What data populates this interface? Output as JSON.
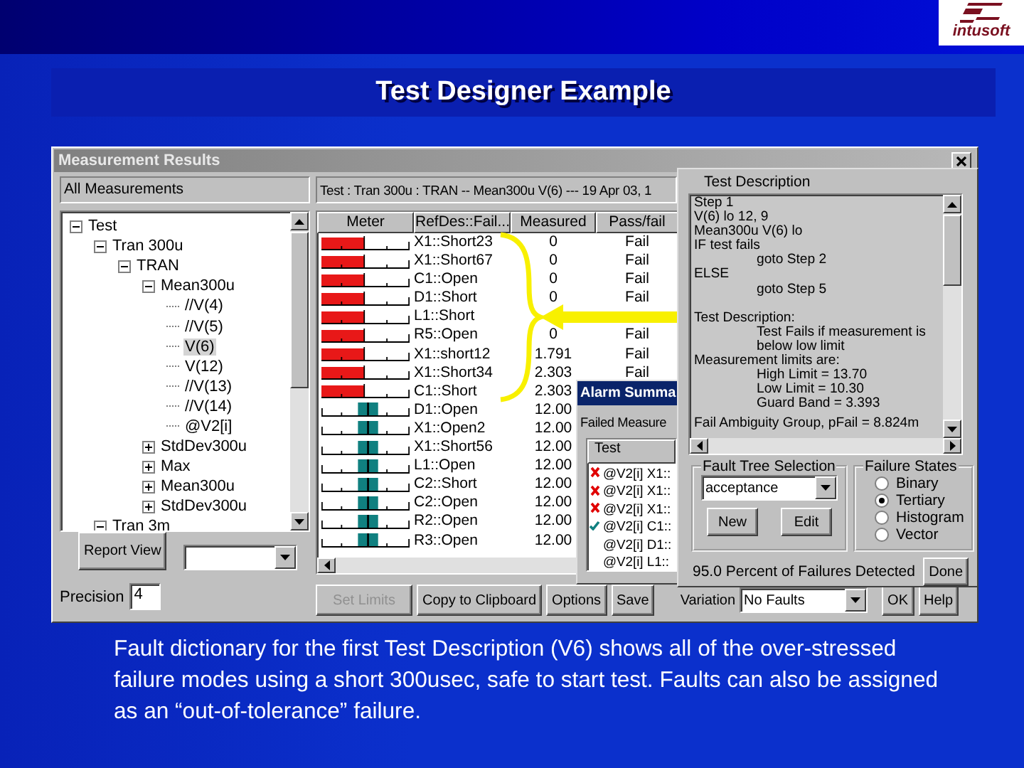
{
  "slide": {
    "logo": "intusoft",
    "title": "Test Designer Example",
    "caption": "Fault dictionary for the first Test Description (V6) shows all of the over-stressed failure modes using a short 300usec, safe to start test. Faults can also be assigned as an “out-of-tolerance” failure."
  },
  "window": {
    "title": "Measurement Results",
    "tree_label": "All Measurements",
    "tree": [
      {
        "label": "Test",
        "expanded": true,
        "selected": false,
        "children": [
          {
            "label": "Tran 300u",
            "expanded": true,
            "selected": false,
            "children": [
              {
                "label": "TRAN",
                "expanded": true,
                "selected": false,
                "children": [
                  {
                    "label": "Mean300u",
                    "expanded": true,
                    "selected": false,
                    "children": [
                      {
                        "label": "//V(4)",
                        "selected": false
                      },
                      {
                        "label": "//V(5)",
                        "selected": false
                      },
                      {
                        "label": "V(6)",
                        "selected": true
                      },
                      {
                        "label": "V(12)",
                        "selected": false
                      },
                      {
                        "label": "//V(13)",
                        "selected": false
                      },
                      {
                        "label": "//V(14)",
                        "selected": false
                      },
                      {
                        "label": "@V2[i]",
                        "selected": false
                      }
                    ]
                  },
                  {
                    "label": "StdDev300u",
                    "expanded": false,
                    "selected": false
                  },
                  {
                    "label": "Max",
                    "expanded": false,
                    "selected": false
                  },
                  {
                    "label": "Mean300u",
                    "expanded": false,
                    "selected": false
                  },
                  {
                    "label": "StdDev300u",
                    "expanded": false,
                    "selected": false
                  }
                ]
              }
            ]
          },
          {
            "label": "Tran 3m",
            "expanded": true,
            "selected": false
          }
        ]
      }
    ],
    "report_button": "Report View",
    "precision_label": "Precision",
    "precision_value": "4",
    "header": "Test : Tran 300u : TRAN -- Mean300u V(6) --- 19 Apr 03, 1",
    "columns": [
      "Meter",
      "RefDes::Fail...",
      "Measured",
      "Pass/fail"
    ],
    "rows": [
      {
        "kind": "fail",
        "refdes": "X1::Short23",
        "measured": "0",
        "result": "Fail"
      },
      {
        "kind": "fail",
        "refdes": "X1::Short67",
        "measured": "0",
        "result": "Fail"
      },
      {
        "kind": "fail",
        "refdes": "C1::Open",
        "measured": "0",
        "result": "Fail"
      },
      {
        "kind": "fail",
        "refdes": "D1::Short",
        "measured": "0",
        "result": "Fail"
      },
      {
        "kind": "fail",
        "refdes": "L1::Short"
      },
      {
        "kind": "fail",
        "refdes": "R5::Open",
        "measured": "0",
        "result": "Fail"
      },
      {
        "kind": "fail",
        "refdes": "X1::short12",
        "measured": "1.791",
        "result": "Fail"
      },
      {
        "kind": "fail",
        "refdes": "X1::Short34",
        "measured": "2.303",
        "result": "Fail"
      },
      {
        "kind": "fail",
        "refdes": "C1::Short",
        "measured": "2.303"
      },
      {
        "kind": "pass",
        "refdes": "D1::Open",
        "measured": "12.00"
      },
      {
        "kind": "pass",
        "refdes": "X1::Open2",
        "measured": "12.00"
      },
      {
        "kind": "pass",
        "refdes": "X1::Short56",
        "measured": "12.00"
      },
      {
        "kind": "pass",
        "refdes": "L1::Open",
        "measured": "12.00"
      },
      {
        "kind": "pass",
        "refdes": "C2::Short",
        "measured": "12.00"
      },
      {
        "kind": "pass",
        "refdes": "C2::Open",
        "measured": "12.00"
      },
      {
        "kind": "pass",
        "refdes": "R2::Open",
        "measured": "12.00"
      },
      {
        "kind": "pass",
        "refdes": "R3::Open",
        "measured": "12.00"
      }
    ],
    "buttons": [
      {
        "label": "Set Limits",
        "disabled": true
      },
      {
        "label": "Copy to Clipboard",
        "disabled": false
      },
      {
        "label": "Options",
        "disabled": false
      },
      {
        "label": "Save",
        "disabled": false
      }
    ],
    "variation_label": "Variation",
    "variation_value": "No Faults",
    "dialog_buttons": [
      "OK",
      "Help"
    ]
  },
  "alarm_summary": {
    "title": "Alarm Summa",
    "label": "Failed Measure",
    "column": "Test",
    "rows": [
      {
        "kind": "fail",
        "text": "@V2[i] X1::"
      },
      {
        "kind": "fail",
        "text": "@V2[i] X1::"
      },
      {
        "kind": "fail",
        "text": "@V2[i] X1::"
      },
      {
        "kind": "pass",
        "text": "@V2[i] C1::"
      },
      {
        "kind": "none",
        "text": "@V2[i] D1::"
      },
      {
        "kind": "none",
        "text": "@V2[i] L1::"
      }
    ]
  },
  "test_description": {
    "label": "Test Description",
    "lines": [
      {
        "kind": "line",
        "text": "Step 1"
      },
      {
        "kind": "line",
        "text": "V(6) lo  12, 9"
      },
      {
        "kind": "line",
        "text": "Mean300u V(6) lo"
      },
      {
        "kind": "line",
        "text": "IF test fails"
      },
      {
        "kind": "indented",
        "text": "goto Step 2"
      },
      {
        "kind": "line",
        "text": "ELSE"
      },
      {
        "kind": "indented",
        "text": "goto Step 5"
      },
      {
        "kind": "section",
        "text": "Test Description:"
      },
      {
        "kind": "indented",
        "text": "Test Fails if measurement is below low limit"
      },
      {
        "kind": "line",
        "text": "Measurement limits are:"
      },
      {
        "kind": "indented",
        "text": "High Limit = 13.70"
      },
      {
        "kind": "indented",
        "text": "Low Limit = 10.30"
      },
      {
        "kind": "indented",
        "text": "Guard Band = 3.393"
      },
      {
        "kind": "section",
        "text": "Fail Ambiguity Group, pFail = 8.824m"
      }
    ],
    "fault_tree": {
      "label": "Fault Tree Selection",
      "value": "acceptance",
      "buttons": [
        "New",
        "Edit"
      ]
    },
    "failure_states": {
      "label": "Failure States",
      "options": [
        {
          "label": "Binary",
          "selected": false
        },
        {
          "label": "Tertiary",
          "selected": true
        },
        {
          "label": "Histogram",
          "selected": false
        },
        {
          "label": "Vector",
          "selected": false
        }
      ]
    },
    "detected": "95.0 Percent of Failures Detected",
    "done": "Done"
  }
}
